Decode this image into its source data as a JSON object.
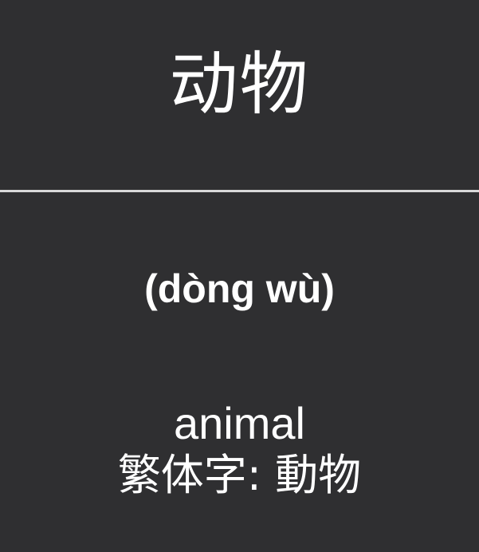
{
  "card": {
    "front": {
      "hanzi": "动物"
    },
    "back": {
      "pinyin": "(dòng wù)",
      "meaning": "animal",
      "traditional": "繁体字: 動物"
    }
  },
  "colors": {
    "background": "#2f2f31",
    "text": "#ffffff",
    "divider": "#d9d9d9"
  }
}
